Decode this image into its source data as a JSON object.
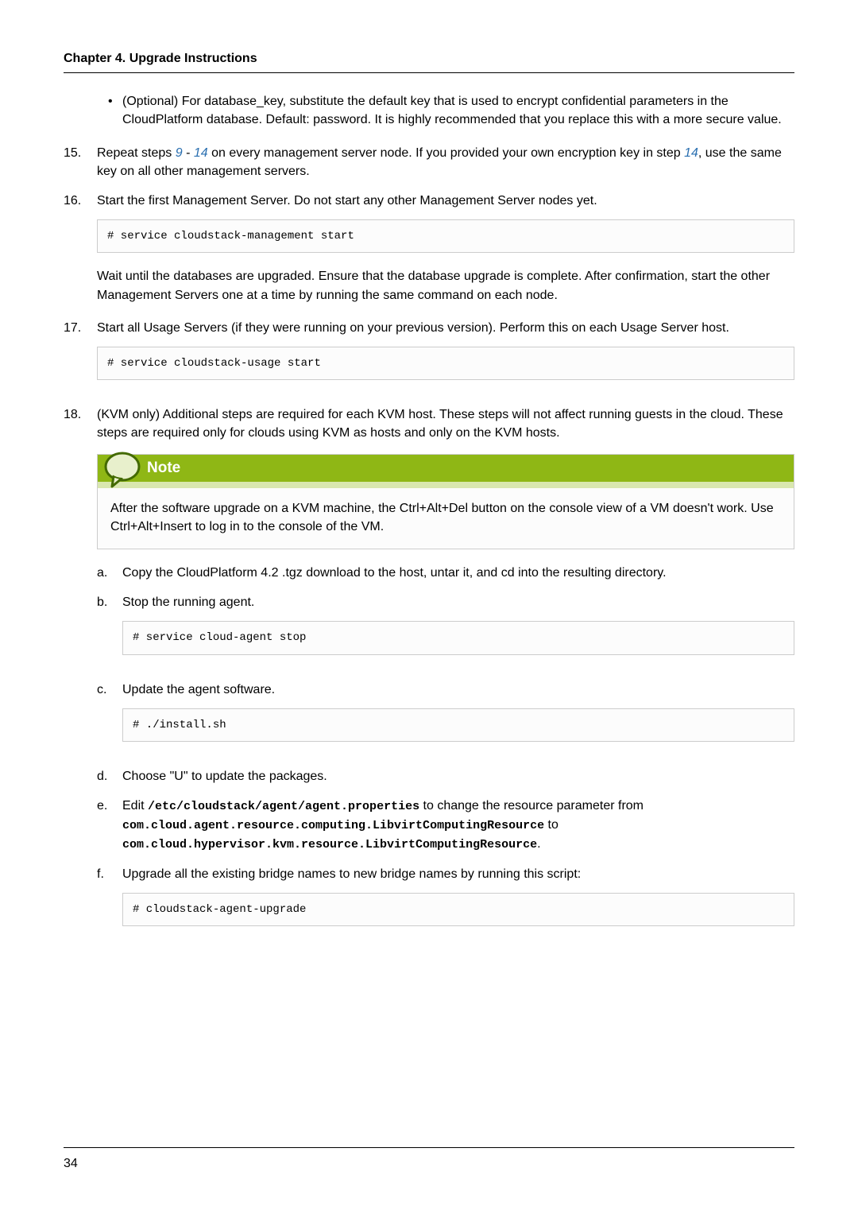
{
  "header": "Chapter 4. Upgrade Instructions",
  "bullet1": "(Optional) For database_key, substitute the default key that is used to encrypt confidential parameters in the CloudPlatform database. Default: password. It is highly recommended that you replace this with a more secure value.",
  "s15": {
    "num": "15.",
    "t1": "Repeat steps ",
    "l1": "9",
    "t2": " - ",
    "l2": "14",
    "t3": " on every management server node. If you provided your own encryption key in step ",
    "l3": "14",
    "t4": ", use the same key on all other management servers."
  },
  "s16": {
    "num": "16.",
    "text": "Start the first Management Server. Do not start any other Management Server nodes yet.",
    "code": "# service cloudstack-management start",
    "after": "Wait until the databases are upgraded. Ensure that the database upgrade is complete. After confirmation, start the other Management Servers one at a time by running the same command on each node."
  },
  "s17": {
    "num": "17.",
    "text": "Start all Usage Servers (if they were running on your previous version). Perform this on each Usage Server host.",
    "code": "# service cloudstack-usage start"
  },
  "s18": {
    "num": "18.",
    "text": "(KVM only) Additional steps are required for each KVM host. These steps will not affect running guests in the cloud. These steps are required only for clouds using KVM as hosts and only on the KVM hosts.",
    "note_title": "Note",
    "note_body": "After the software upgrade on a KVM machine, the Ctrl+Alt+Del button on the console view of a VM doesn't work. Use Ctrl+Alt+Insert to log in to the console of the VM.",
    "a": {
      "n": "a.",
      "t": "Copy the CloudPlatform 4.2 .tgz download to the host, untar it, and cd into the resulting directory."
    },
    "b": {
      "n": "b.",
      "t": "Stop the running agent.",
      "code": "# service cloud-agent stop"
    },
    "c": {
      "n": "c.",
      "t": "Update the agent software.",
      "code": "# ./install.sh"
    },
    "d": {
      "n": "d.",
      "t": "Choose \"U\" to update the packages."
    },
    "e": {
      "n": "e.",
      "t1": "Edit ",
      "f1": "/etc/cloudstack/agent/agent.properties",
      "t2": " to change the resource parameter from ",
      "f2": "com.cloud.agent.resource.computing.LibvirtComputingResource",
      "t3": " to ",
      "f3": "com.cloud.hypervisor.kvm.resource.LibvirtComputingResource",
      "t4": "."
    },
    "f": {
      "n": "f.",
      "t": "Upgrade all the existing bridge names to new bridge names by running this script:",
      "code": "# cloudstack-agent-upgrade"
    }
  },
  "pagenum": "34"
}
